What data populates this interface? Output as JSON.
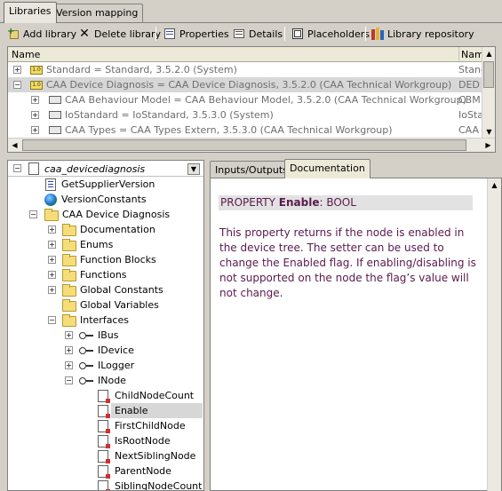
{
  "tabs": [
    {
      "label": "Libraries"
    },
    {
      "label": "Version mapping"
    }
  ],
  "toolbar": {
    "add_library": "Add library",
    "delete_library": "Delete library",
    "properties": "Properties",
    "details": "Details",
    "placeholders": "Placeholders",
    "library_repository": "Library repository"
  },
  "libtable": {
    "columns": [
      "Name",
      "Name"
    ],
    "rows": [
      {
        "name": "Standard = Standard, 3.5.2.0 (System)",
        "col2": "Stand"
      },
      {
        "name": "CAA Device Diagnosis = CAA Device Diagnosis, 3.5.2.0 (CAA Technical Workgroup)",
        "col2": "DED"
      },
      {
        "name": "CAA Behaviour Model = CAA Behaviour Model, 3.5.2.0 (CAA Technical Workgroup)",
        "col2": "CBM"
      },
      {
        "name": "IoStandard = IoStandard, 3.5.3.0 (System)",
        "col2": "IoStan"
      },
      {
        "name": "CAA Types = CAA Types Extern, 3.5.3.0 (CAA Technical Workgroup)",
        "col2": "CAA"
      }
    ]
  },
  "tree": {
    "root": "caa_devicediagnosis",
    "items": [
      {
        "label": "GetSupplierVersion"
      },
      {
        "label": "VersionConstants"
      },
      {
        "label": "CAA Device Diagnosis"
      },
      {
        "label": "Documentation"
      },
      {
        "label": "Enums"
      },
      {
        "label": "Function Blocks"
      },
      {
        "label": "Functions"
      },
      {
        "label": "Global Constants"
      },
      {
        "label": "Global Variables"
      },
      {
        "label": "Interfaces"
      },
      {
        "label": "IBus"
      },
      {
        "label": "IDevice"
      },
      {
        "label": "ILogger"
      },
      {
        "label": "INode"
      },
      {
        "label": "ChildNodeCount"
      },
      {
        "label": "Enable"
      },
      {
        "label": "FirstChildNode"
      },
      {
        "label": "IsRootNode"
      },
      {
        "label": "NextSiblingNode"
      },
      {
        "label": "ParentNode"
      },
      {
        "label": "SiblingNodeCount"
      }
    ]
  },
  "doc_tabs": [
    {
      "label": "Inputs/Outputs"
    },
    {
      "label": "Documentation"
    }
  ],
  "documentation": {
    "prop_keyword": "PROPERTY ",
    "prop_name": "Enable",
    "prop_type": ": BOOL",
    "description": "This property returns if the node is enabled in the device tree. The setter can be used to change the Enabled flag. If enabling/disabling is not supported on the node the flag’s value will not change."
  },
  "colors": {
    "background": "#d4d0c8",
    "doc_text": "#5a1a4e",
    "selection": "#d7d7d7"
  }
}
